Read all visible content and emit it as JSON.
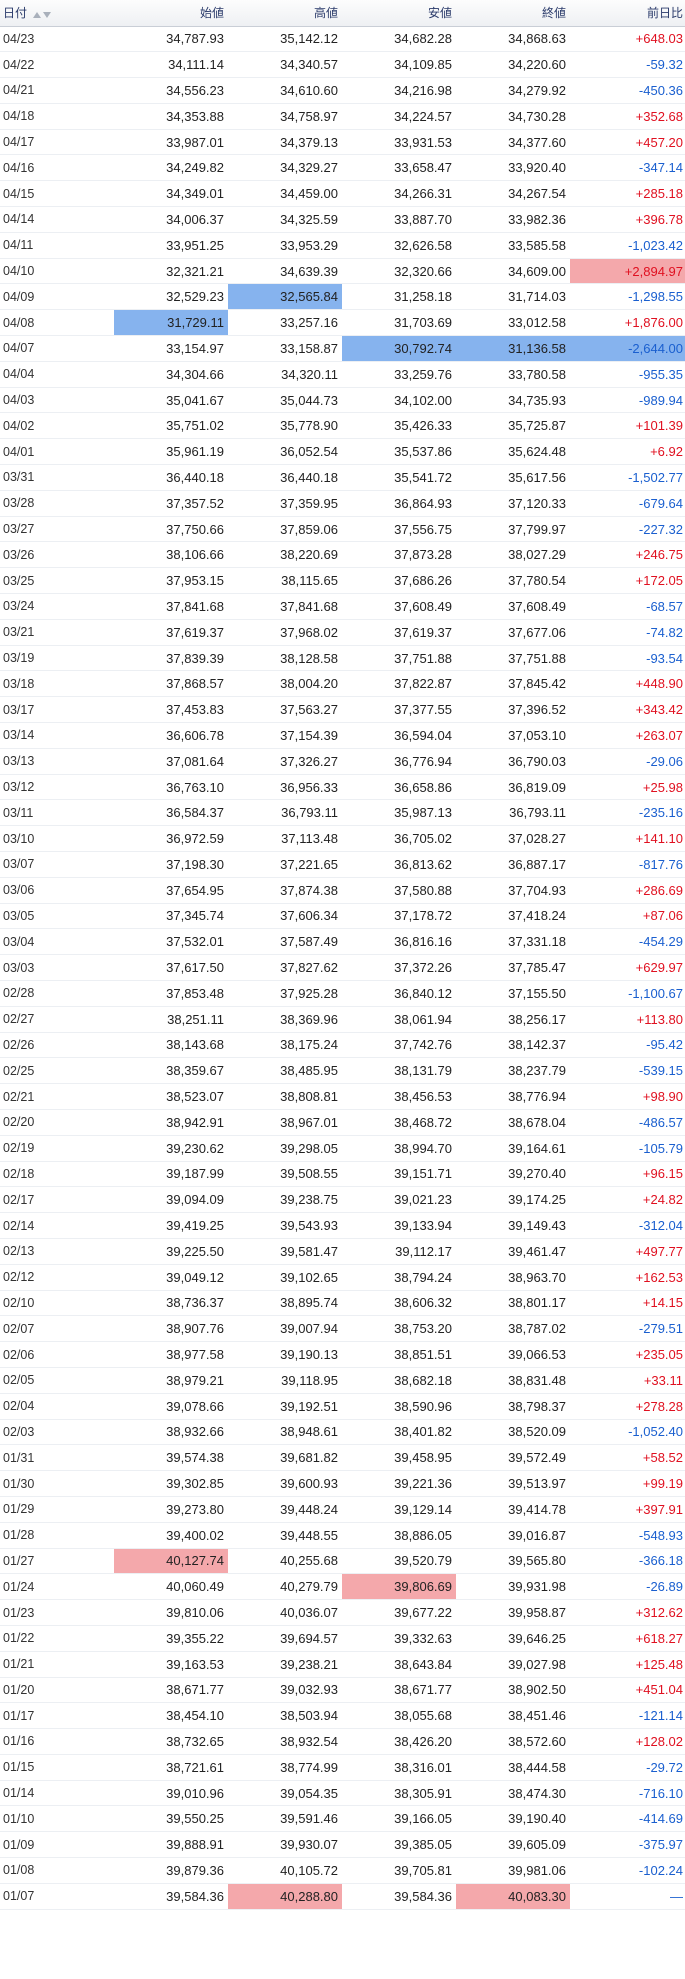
{
  "columns": {
    "date": "日付",
    "open": "始値",
    "high": "高値",
    "low": "安値",
    "close": "終値",
    "change": "前日比"
  },
  "sort_icons": [
    "sort-ascending-icon",
    "sort-descending-icon"
  ],
  "colors": {
    "up": "#e01020",
    "down": "#1a5fcf",
    "highlight_blue": "#86b3ee",
    "highlight_red": "#f4a8ab"
  },
  "rows": [
    {
      "date": "04/23",
      "open": "34,787.93",
      "high": "35,142.12",
      "low": "34,682.28",
      "close": "34,868.63",
      "change": "+648.03",
      "dir": "up"
    },
    {
      "date": "04/22",
      "open": "34,111.14",
      "high": "34,340.57",
      "low": "34,109.85",
      "close": "34,220.60",
      "change": "-59.32",
      "dir": "down"
    },
    {
      "date": "04/21",
      "open": "34,556.23",
      "high": "34,610.60",
      "low": "34,216.98",
      "close": "34,279.92",
      "change": "-450.36",
      "dir": "down"
    },
    {
      "date": "04/18",
      "open": "34,353.88",
      "high": "34,758.97",
      "low": "34,224.57",
      "close": "34,730.28",
      "change": "+352.68",
      "dir": "up"
    },
    {
      "date": "04/17",
      "open": "33,987.01",
      "high": "34,379.13",
      "low": "33,931.53",
      "close": "34,377.60",
      "change": "+457.20",
      "dir": "up"
    },
    {
      "date": "04/16",
      "open": "34,249.82",
      "high": "34,329.27",
      "low": "33,658.47",
      "close": "33,920.40",
      "change": "-347.14",
      "dir": "down"
    },
    {
      "date": "04/15",
      "open": "34,349.01",
      "high": "34,459.00",
      "low": "34,266.31",
      "close": "34,267.54",
      "change": "+285.18",
      "dir": "up"
    },
    {
      "date": "04/14",
      "open": "34,006.37",
      "high": "34,325.59",
      "low": "33,887.70",
      "close": "33,982.36",
      "change": "+396.78",
      "dir": "up"
    },
    {
      "date": "04/11",
      "open": "33,951.25",
      "high": "33,953.29",
      "low": "32,626.58",
      "close": "33,585.58",
      "change": "-1,023.42",
      "dir": "down"
    },
    {
      "date": "04/10",
      "open": "32,321.21",
      "high": "34,639.39",
      "low": "32,320.66",
      "close": "34,609.00",
      "change": "+2,894.97",
      "dir": "up",
      "hl": {
        "change": "red"
      }
    },
    {
      "date": "04/09",
      "open": "32,529.23",
      "high": "32,565.84",
      "low": "31,258.18",
      "close": "31,714.03",
      "change": "-1,298.55",
      "dir": "down",
      "hl": {
        "high": "blue"
      }
    },
    {
      "date": "04/08",
      "open": "31,729.11",
      "high": "33,257.16",
      "low": "31,703.69",
      "close": "33,012.58",
      "change": "+1,876.00",
      "dir": "up",
      "hl": {
        "open": "blue"
      }
    },
    {
      "date": "04/07",
      "open": "33,154.97",
      "high": "33,158.87",
      "low": "30,792.74",
      "close": "31,136.58",
      "change": "-2,644.00",
      "dir": "down",
      "hl": {
        "low": "blue",
        "close": "blue",
        "change": "blue"
      }
    },
    {
      "date": "04/04",
      "open": "34,304.66",
      "high": "34,320.11",
      "low": "33,259.76",
      "close": "33,780.58",
      "change": "-955.35",
      "dir": "down"
    },
    {
      "date": "04/03",
      "open": "35,041.67",
      "high": "35,044.73",
      "low": "34,102.00",
      "close": "34,735.93",
      "change": "-989.94",
      "dir": "down"
    },
    {
      "date": "04/02",
      "open": "35,751.02",
      "high": "35,778.90",
      "low": "35,426.33",
      "close": "35,725.87",
      "change": "+101.39",
      "dir": "up"
    },
    {
      "date": "04/01",
      "open": "35,961.19",
      "high": "36,052.54",
      "low": "35,537.86",
      "close": "35,624.48",
      "change": "+6.92",
      "dir": "up"
    },
    {
      "date": "03/31",
      "open": "36,440.18",
      "high": "36,440.18",
      "low": "35,541.72",
      "close": "35,617.56",
      "change": "-1,502.77",
      "dir": "down"
    },
    {
      "date": "03/28",
      "open": "37,357.52",
      "high": "37,359.95",
      "low": "36,864.93",
      "close": "37,120.33",
      "change": "-679.64",
      "dir": "down"
    },
    {
      "date": "03/27",
      "open": "37,750.66",
      "high": "37,859.06",
      "low": "37,556.75",
      "close": "37,799.97",
      "change": "-227.32",
      "dir": "down"
    },
    {
      "date": "03/26",
      "open": "38,106.66",
      "high": "38,220.69",
      "low": "37,873.28",
      "close": "38,027.29",
      "change": "+246.75",
      "dir": "up"
    },
    {
      "date": "03/25",
      "open": "37,953.15",
      "high": "38,115.65",
      "low": "37,686.26",
      "close": "37,780.54",
      "change": "+172.05",
      "dir": "up"
    },
    {
      "date": "03/24",
      "open": "37,841.68",
      "high": "37,841.68",
      "low": "37,608.49",
      "close": "37,608.49",
      "change": "-68.57",
      "dir": "down"
    },
    {
      "date": "03/21",
      "open": "37,619.37",
      "high": "37,968.02",
      "low": "37,619.37",
      "close": "37,677.06",
      "change": "-74.82",
      "dir": "down"
    },
    {
      "date": "03/19",
      "open": "37,839.39",
      "high": "38,128.58",
      "low": "37,751.88",
      "close": "37,751.88",
      "change": "-93.54",
      "dir": "down"
    },
    {
      "date": "03/18",
      "open": "37,868.57",
      "high": "38,004.20",
      "low": "37,822.87",
      "close": "37,845.42",
      "change": "+448.90",
      "dir": "up"
    },
    {
      "date": "03/17",
      "open": "37,453.83",
      "high": "37,563.27",
      "low": "37,377.55",
      "close": "37,396.52",
      "change": "+343.42",
      "dir": "up"
    },
    {
      "date": "03/14",
      "open": "36,606.78",
      "high": "37,154.39",
      "low": "36,594.04",
      "close": "37,053.10",
      "change": "+263.07",
      "dir": "up"
    },
    {
      "date": "03/13",
      "open": "37,081.64",
      "high": "37,326.27",
      "low": "36,776.94",
      "close": "36,790.03",
      "change": "-29.06",
      "dir": "down"
    },
    {
      "date": "03/12",
      "open": "36,763.10",
      "high": "36,956.33",
      "low": "36,658.86",
      "close": "36,819.09",
      "change": "+25.98",
      "dir": "up"
    },
    {
      "date": "03/11",
      "open": "36,584.37",
      "high": "36,793.11",
      "low": "35,987.13",
      "close": "36,793.11",
      "change": "-235.16",
      "dir": "down"
    },
    {
      "date": "03/10",
      "open": "36,972.59",
      "high": "37,113.48",
      "low": "36,705.02",
      "close": "37,028.27",
      "change": "+141.10",
      "dir": "up"
    },
    {
      "date": "03/07",
      "open": "37,198.30",
      "high": "37,221.65",
      "low": "36,813.62",
      "close": "36,887.17",
      "change": "-817.76",
      "dir": "down"
    },
    {
      "date": "03/06",
      "open": "37,654.95",
      "high": "37,874.38",
      "low": "37,580.88",
      "close": "37,704.93",
      "change": "+286.69",
      "dir": "up"
    },
    {
      "date": "03/05",
      "open": "37,345.74",
      "high": "37,606.34",
      "low": "37,178.72",
      "close": "37,418.24",
      "change": "+87.06",
      "dir": "up"
    },
    {
      "date": "03/04",
      "open": "37,532.01",
      "high": "37,587.49",
      "low": "36,816.16",
      "close": "37,331.18",
      "change": "-454.29",
      "dir": "down"
    },
    {
      "date": "03/03",
      "open": "37,617.50",
      "high": "37,827.62",
      "low": "37,372.26",
      "close": "37,785.47",
      "change": "+629.97",
      "dir": "up"
    },
    {
      "date": "02/28",
      "open": "37,853.48",
      "high": "37,925.28",
      "low": "36,840.12",
      "close": "37,155.50",
      "change": "-1,100.67",
      "dir": "down"
    },
    {
      "date": "02/27",
      "open": "38,251.11",
      "high": "38,369.96",
      "low": "38,061.94",
      "close": "38,256.17",
      "change": "+113.80",
      "dir": "up"
    },
    {
      "date": "02/26",
      "open": "38,143.68",
      "high": "38,175.24",
      "low": "37,742.76",
      "close": "38,142.37",
      "change": "-95.42",
      "dir": "down"
    },
    {
      "date": "02/25",
      "open": "38,359.67",
      "high": "38,485.95",
      "low": "38,131.79",
      "close": "38,237.79",
      "change": "-539.15",
      "dir": "down"
    },
    {
      "date": "02/21",
      "open": "38,523.07",
      "high": "38,808.81",
      "low": "38,456.53",
      "close": "38,776.94",
      "change": "+98.90",
      "dir": "up"
    },
    {
      "date": "02/20",
      "open": "38,942.91",
      "high": "38,967.01",
      "low": "38,468.72",
      "close": "38,678.04",
      "change": "-486.57",
      "dir": "down"
    },
    {
      "date": "02/19",
      "open": "39,230.62",
      "high": "39,298.05",
      "low": "38,994.70",
      "close": "39,164.61",
      "change": "-105.79",
      "dir": "down"
    },
    {
      "date": "02/18",
      "open": "39,187.99",
      "high": "39,508.55",
      "low": "39,151.71",
      "close": "39,270.40",
      "change": "+96.15",
      "dir": "up"
    },
    {
      "date": "02/17",
      "open": "39,094.09",
      "high": "39,238.75",
      "low": "39,021.23",
      "close": "39,174.25",
      "change": "+24.82",
      "dir": "up"
    },
    {
      "date": "02/14",
      "open": "39,419.25",
      "high": "39,543.93",
      "low": "39,133.94",
      "close": "39,149.43",
      "change": "-312.04",
      "dir": "down"
    },
    {
      "date": "02/13",
      "open": "39,225.50",
      "high": "39,581.47",
      "low": "39,112.17",
      "close": "39,461.47",
      "change": "+497.77",
      "dir": "up"
    },
    {
      "date": "02/12",
      "open": "39,049.12",
      "high": "39,102.65",
      "low": "38,794.24",
      "close": "38,963.70",
      "change": "+162.53",
      "dir": "up"
    },
    {
      "date": "02/10",
      "open": "38,736.37",
      "high": "38,895.74",
      "low": "38,606.32",
      "close": "38,801.17",
      "change": "+14.15",
      "dir": "up"
    },
    {
      "date": "02/07",
      "open": "38,907.76",
      "high": "39,007.94",
      "low": "38,753.20",
      "close": "38,787.02",
      "change": "-279.51",
      "dir": "down"
    },
    {
      "date": "02/06",
      "open": "38,977.58",
      "high": "39,190.13",
      "low": "38,851.51",
      "close": "39,066.53",
      "change": "+235.05",
      "dir": "up"
    },
    {
      "date": "02/05",
      "open": "38,979.21",
      "high": "39,118.95",
      "low": "38,682.18",
      "close": "38,831.48",
      "change": "+33.11",
      "dir": "up"
    },
    {
      "date": "02/04",
      "open": "39,078.66",
      "high": "39,192.51",
      "low": "38,590.96",
      "close": "38,798.37",
      "change": "+278.28",
      "dir": "up"
    },
    {
      "date": "02/03",
      "open": "38,932.66",
      "high": "38,948.61",
      "low": "38,401.82",
      "close": "38,520.09",
      "change": "-1,052.40",
      "dir": "down"
    },
    {
      "date": "01/31",
      "open": "39,574.38",
      "high": "39,681.82",
      "low": "39,458.95",
      "close": "39,572.49",
      "change": "+58.52",
      "dir": "up"
    },
    {
      "date": "01/30",
      "open": "39,302.85",
      "high": "39,600.93",
      "low": "39,221.36",
      "close": "39,513.97",
      "change": "+99.19",
      "dir": "up"
    },
    {
      "date": "01/29",
      "open": "39,273.80",
      "high": "39,448.24",
      "low": "39,129.14",
      "close": "39,414.78",
      "change": "+397.91",
      "dir": "up"
    },
    {
      "date": "01/28",
      "open": "39,400.02",
      "high": "39,448.55",
      "low": "38,886.05",
      "close": "39,016.87",
      "change": "-548.93",
      "dir": "down"
    },
    {
      "date": "01/27",
      "open": "40,127.74",
      "high": "40,255.68",
      "low": "39,520.79",
      "close": "39,565.80",
      "change": "-366.18",
      "dir": "down",
      "hl": {
        "open": "red"
      }
    },
    {
      "date": "01/24",
      "open": "40,060.49",
      "high": "40,279.79",
      "low": "39,806.69",
      "close": "39,931.98",
      "change": "-26.89",
      "dir": "down",
      "hl": {
        "low": "red"
      }
    },
    {
      "date": "01/23",
      "open": "39,810.06",
      "high": "40,036.07",
      "low": "39,677.22",
      "close": "39,958.87",
      "change": "+312.62",
      "dir": "up"
    },
    {
      "date": "01/22",
      "open": "39,355.22",
      "high": "39,694.57",
      "low": "39,332.63",
      "close": "39,646.25",
      "change": "+618.27",
      "dir": "up"
    },
    {
      "date": "01/21",
      "open": "39,163.53",
      "high": "39,238.21",
      "low": "38,643.84",
      "close": "39,027.98",
      "change": "+125.48",
      "dir": "up"
    },
    {
      "date": "01/20",
      "open": "38,671.77",
      "high": "39,032.93",
      "low": "38,671.77",
      "close": "38,902.50",
      "change": "+451.04",
      "dir": "up"
    },
    {
      "date": "01/17",
      "open": "38,454.10",
      "high": "38,503.94",
      "low": "38,055.68",
      "close": "38,451.46",
      "change": "-121.14",
      "dir": "down"
    },
    {
      "date": "01/16",
      "open": "38,732.65",
      "high": "38,932.54",
      "low": "38,426.20",
      "close": "38,572.60",
      "change": "+128.02",
      "dir": "up"
    },
    {
      "date": "01/15",
      "open": "38,721.61",
      "high": "38,774.99",
      "low": "38,316.01",
      "close": "38,444.58",
      "change": "-29.72",
      "dir": "down"
    },
    {
      "date": "01/14",
      "open": "39,010.96",
      "high": "39,054.35",
      "low": "38,305.91",
      "close": "38,474.30",
      "change": "-716.10",
      "dir": "down"
    },
    {
      "date": "01/10",
      "open": "39,550.25",
      "high": "39,591.46",
      "low": "39,166.05",
      "close": "39,190.40",
      "change": "-414.69",
      "dir": "down"
    },
    {
      "date": "01/09",
      "open": "39,888.91",
      "high": "39,930.07",
      "low": "39,385.05",
      "close": "39,605.09",
      "change": "-375.97",
      "dir": "down"
    },
    {
      "date": "01/08",
      "open": "39,879.36",
      "high": "40,105.72",
      "low": "39,705.81",
      "close": "39,981.06",
      "change": "-102.24",
      "dir": "down"
    },
    {
      "date": "01/07",
      "open": "39,584.36",
      "high": "40,288.80",
      "low": "39,584.36",
      "close": "40,083.30",
      "change": "—",
      "dir": "flat",
      "hl": {
        "high": "red",
        "close": "red"
      }
    }
  ]
}
